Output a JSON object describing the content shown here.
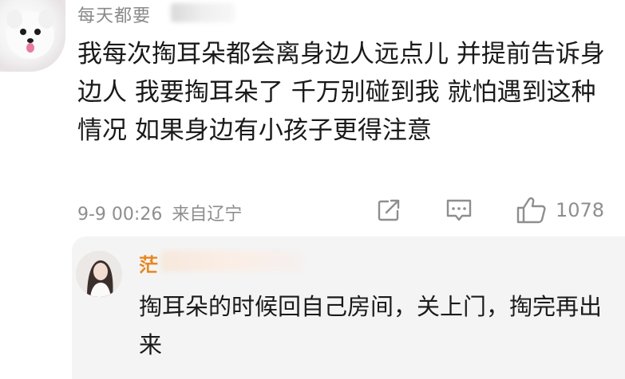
{
  "comment": {
    "username": "每天都要",
    "text": "我每次掏耳朵都会离身边人远点儿 并提前告诉身边人 我要掏耳朵了 千万别碰到我 就怕遇到这种情况 如果身边有小孩子更得注意",
    "time": "9-9 00:26",
    "location": "来自辽宁",
    "like_count": "1078",
    "icons": {
      "share": "share-icon",
      "reply": "comment-icon",
      "like": "thumbs-up-icon"
    }
  },
  "reply": {
    "username": "茫",
    "text": "掏耳朵的时候回自己房间，关上门，掏完再出来"
  }
}
